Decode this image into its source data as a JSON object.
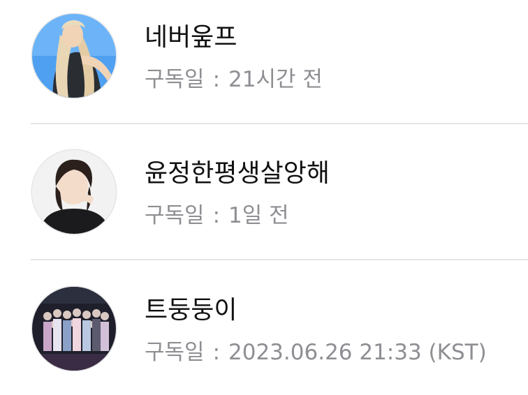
{
  "subscribers": [
    {
      "name": "네버웊프",
      "meta_label": "구독일",
      "meta_separator": ":",
      "meta_value": "21시간 전",
      "avatar_icon": "avatar-photo-blonde-woman-blue-sky"
    },
    {
      "name": "윤정한평생살앙해",
      "meta_label": "구독일",
      "meta_separator": ":",
      "meta_value": "1일 전",
      "avatar_icon": "avatar-photo-woman-hand-pose"
    },
    {
      "name": "트둥둥이",
      "meta_label": "구독일",
      "meta_separator": ":",
      "meta_value": "2023.06.26 21:33 (KST)",
      "avatar_icon": "avatar-photo-group"
    }
  ],
  "colors": {
    "name_text": "#111111",
    "meta_text": "#8e8e93",
    "divider": "#e5e5ea",
    "background": "#ffffff"
  }
}
